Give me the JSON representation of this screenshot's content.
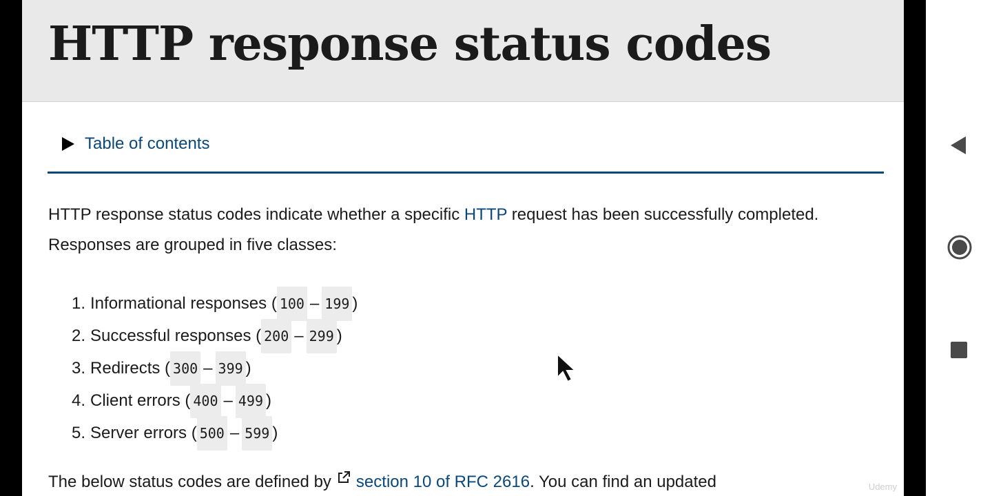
{
  "page": {
    "title": "HTTP response status codes",
    "toc_label": "Table of contents",
    "intro_before": "HTTP response status codes indicate whether a specific ",
    "intro_link": "HTTP",
    "intro_after": " request has been successfully completed. Responses are grouped in five classes:",
    "classes": [
      {
        "num": "1.",
        "label": "Informational responses (",
        "start": "100",
        "dash": "–",
        "end": "199",
        "close": ")"
      },
      {
        "num": "2.",
        "label": "Successful responses (",
        "start": "200",
        "dash": "–",
        "end": "299",
        "close": ")"
      },
      {
        "num": "3.",
        "label": "Redirects (",
        "start": "300",
        "dash": "–",
        "end": "399",
        "close": ")"
      },
      {
        "num": "4.",
        "label": "Client errors (",
        "start": "400",
        "dash": "–",
        "end": "499",
        "close": ")"
      },
      {
        "num": "5.",
        "label": "Server errors (",
        "start": "500",
        "dash": "–",
        "end": "599",
        "close": ")"
      }
    ],
    "footer_before": "The below status codes are defined by",
    "footer_link": "section 10 of RFC 2616",
    "footer_after": ". You can find an updated",
    "watermark": "Udemy"
  },
  "icons": {
    "toc": "triangle-right-icon",
    "external": "external-link-icon",
    "back": "back-triangle-icon",
    "home": "home-circle-icon",
    "recent": "recent-square-icon",
    "cursor": "mouse-pointer-icon"
  },
  "colors": {
    "link": "#0b4778",
    "header_bg": "#e9e9e9",
    "text": "#1b1b1b",
    "code_bg": "#ececec",
    "nav_icon": "#4a4a4a"
  }
}
